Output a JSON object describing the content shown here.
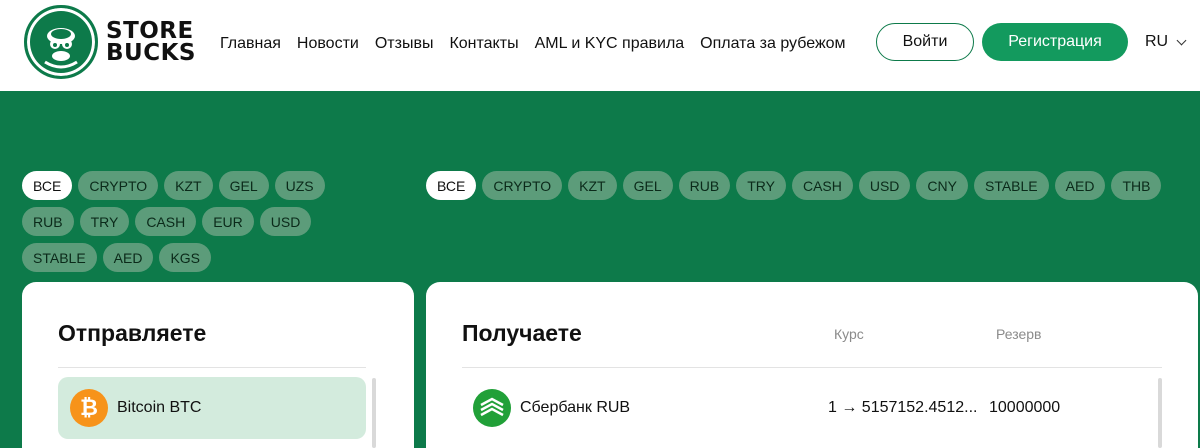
{
  "brand": {
    "line1": "STORE",
    "line2": "BUCKS"
  },
  "nav": [
    "Главная",
    "Новости",
    "Отзывы",
    "Контакты",
    "AML и KYC правила",
    "Оплата за рубежом"
  ],
  "auth": {
    "login": "Войти",
    "register": "Регистрация"
  },
  "lang": "RU",
  "filters_send": [
    "ВСЕ",
    "CRYPTO",
    "KZT",
    "GEL",
    "UZS",
    "RUB",
    "TRY",
    "CASH",
    "EUR",
    "USD",
    "STABLE",
    "AED",
    "KGS"
  ],
  "filters_receive": [
    "ВСЕ",
    "CRYPTO",
    "KZT",
    "GEL",
    "RUB",
    "TRY",
    "CASH",
    "USD",
    "CNY",
    "STABLE",
    "AED",
    "THB"
  ],
  "send": {
    "title": "Отправляете",
    "items": [
      {
        "label": "Bitcoin BTC",
        "symbol": "₿"
      }
    ]
  },
  "receive": {
    "title": "Получаете",
    "col_rate": "Курс",
    "col_reserve": "Резерв",
    "items": [
      {
        "label": "Сбербанк RUB",
        "rate": "1 → 5157152.4512...",
        "reserve": "10000000"
      }
    ]
  },
  "colors": {
    "brand_green": "#0d7a4a",
    "button_green": "#139a5e",
    "chip": "#5c9c7a",
    "selected_bg": "#d3ebdd",
    "btc": "#f7931a"
  }
}
